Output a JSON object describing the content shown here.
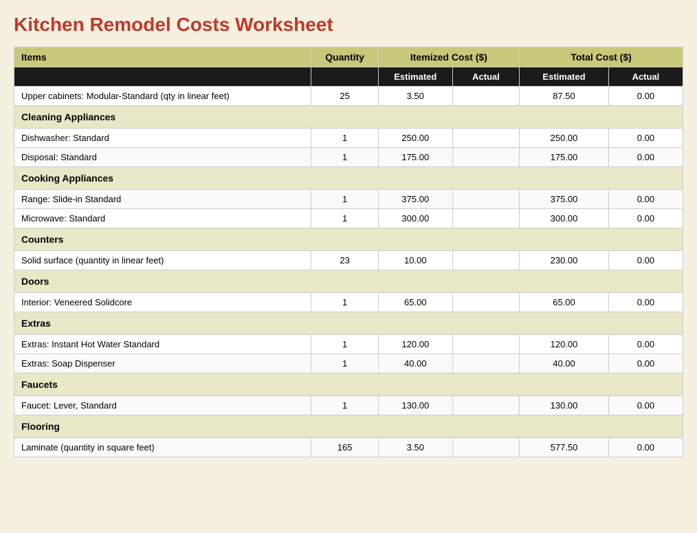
{
  "title": "Kitchen Remodel Costs Worksheet",
  "columns": {
    "items": "Items",
    "quantity": "Quantity",
    "itemized": "Itemized Cost ($)",
    "totalcost": "Total Cost ($)",
    "estimated": "Estimated",
    "actual": "Actual"
  },
  "rows": [
    {
      "type": "data",
      "item": "Upper cabinets: Modular-Standard (qty in linear feet)",
      "qty": "25",
      "est": "3.50",
      "actual": "",
      "total_est": "87.50",
      "total_actual": "0.00"
    },
    {
      "type": "category",
      "item": "Cleaning Appliances"
    },
    {
      "type": "data",
      "item": "Dishwasher: Standard",
      "qty": "1",
      "est": "250.00",
      "actual": "",
      "total_est": "250.00",
      "total_actual": "0.00"
    },
    {
      "type": "data",
      "item": "Disposal: Standard",
      "qty": "1",
      "est": "175.00",
      "actual": "",
      "total_est": "175.00",
      "total_actual": "0.00"
    },
    {
      "type": "category",
      "item": "Cooking Appliances"
    },
    {
      "type": "data",
      "item": "Range: Slide-in Standard",
      "qty": "1",
      "est": "375.00",
      "actual": "",
      "total_est": "375.00",
      "total_actual": "0.00"
    },
    {
      "type": "data",
      "item": "Microwave: Standard",
      "qty": "1",
      "est": "300.00",
      "actual": "",
      "total_est": "300.00",
      "total_actual": "0.00"
    },
    {
      "type": "category",
      "item": "Counters"
    },
    {
      "type": "data",
      "item": "Solid surface (quantity in linear feet)",
      "qty": "23",
      "est": "10.00",
      "actual": "",
      "total_est": "230.00",
      "total_actual": "0.00"
    },
    {
      "type": "category",
      "item": "Doors"
    },
    {
      "type": "data",
      "item": "Interior: Veneered Solidcore",
      "qty": "1",
      "est": "65.00",
      "actual": "",
      "total_est": "65.00",
      "total_actual": "0.00"
    },
    {
      "type": "category",
      "item": "Extras"
    },
    {
      "type": "data",
      "item": "Extras: Instant Hot Water Standard",
      "qty": "1",
      "est": "120.00",
      "actual": "",
      "total_est": "120.00",
      "total_actual": "0.00"
    },
    {
      "type": "data",
      "item": "Extras: Soap Dispenser",
      "qty": "1",
      "est": "40.00",
      "actual": "",
      "total_est": "40.00",
      "total_actual": "0.00"
    },
    {
      "type": "category",
      "item": "Faucets"
    },
    {
      "type": "data",
      "item": "Faucet: Lever, Standard",
      "qty": "1",
      "est": "130.00",
      "actual": "",
      "total_est": "130.00",
      "total_actual": "0.00"
    },
    {
      "type": "category",
      "item": "Flooring"
    },
    {
      "type": "data",
      "item": "Laminate (quantity in square feet)",
      "qty": "165",
      "est": "3.50",
      "actual": "",
      "total_est": "577.50",
      "total_actual": "0.00"
    }
  ]
}
